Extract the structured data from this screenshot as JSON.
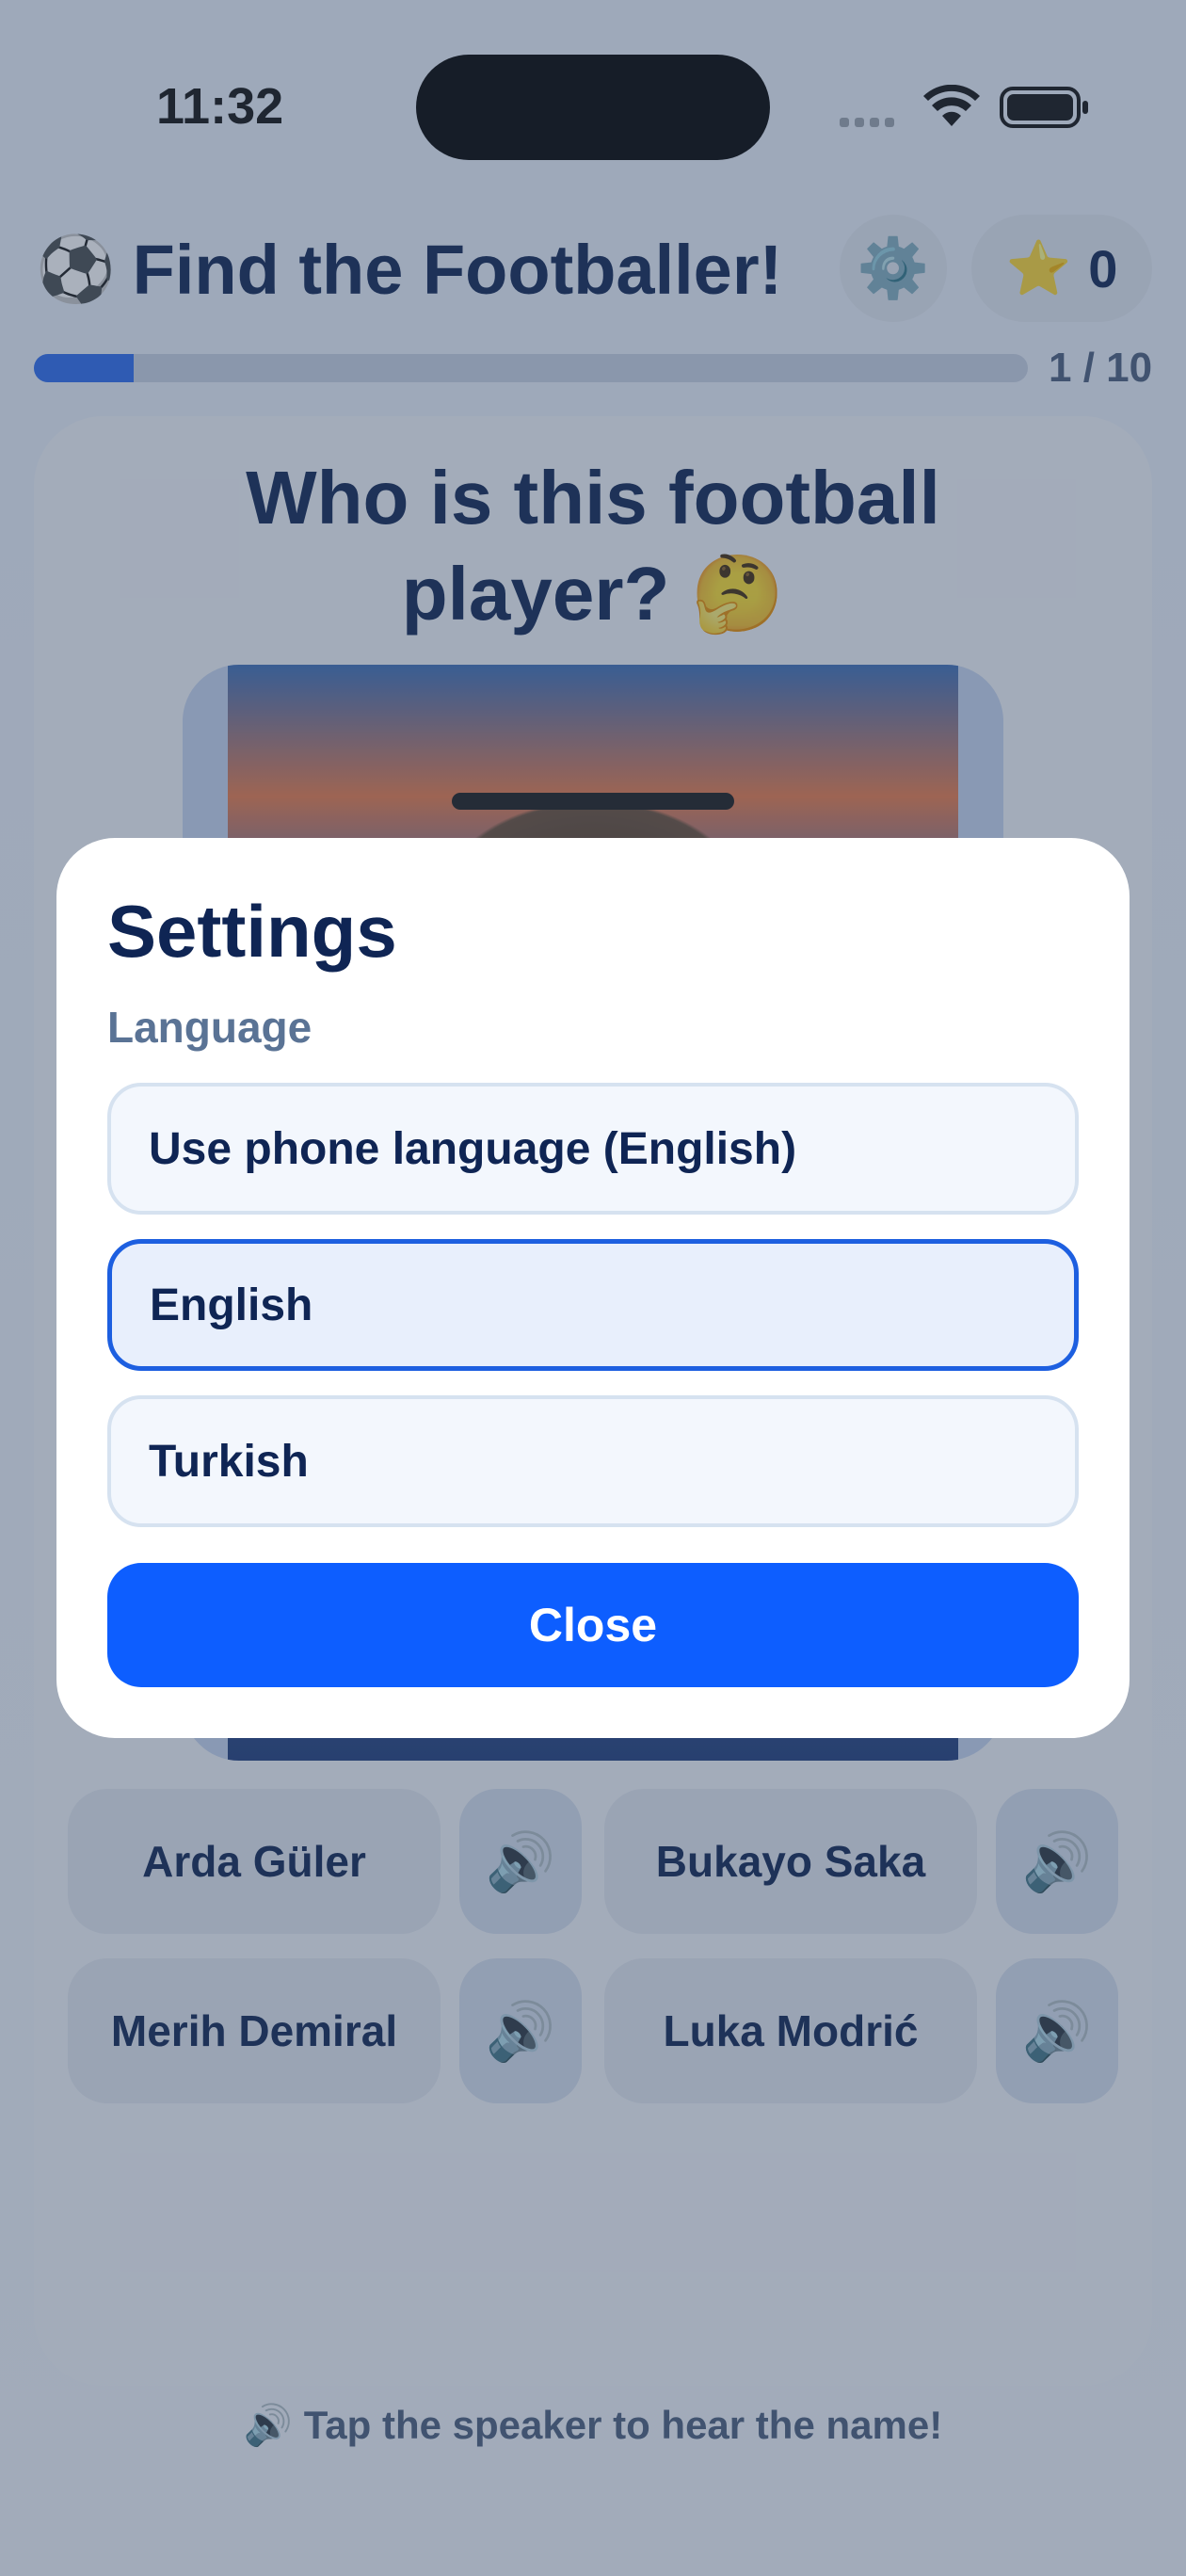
{
  "status_bar": {
    "time": "11:32"
  },
  "header": {
    "title": "Find the Footballer!",
    "ball_emoji": "⚽",
    "settings_emoji": "⚙️",
    "star_emoji": "⭐",
    "score": "0"
  },
  "progress": {
    "text": "1 / 10",
    "value": 0.1
  },
  "question": {
    "text": "Who is this football player? 🤔"
  },
  "options": [
    {
      "label": "Arda Güler"
    },
    {
      "label": "Bukayo Saka"
    },
    {
      "label": "Merih Demiral"
    },
    {
      "label": "Luka Modrić"
    }
  ],
  "speaker_emoji": "🔊",
  "hint": "🔊 Tap the speaker to hear the name!",
  "settings_modal": {
    "title": "Settings",
    "section_label": "Language",
    "language_options": [
      {
        "label": "Use phone language (English)",
        "selected": false
      },
      {
        "label": "English",
        "selected": true
      },
      {
        "label": "Turkish",
        "selected": false
      }
    ],
    "close_label": "Close"
  },
  "colors": {
    "accent": "#0d5eff",
    "title": "#0f2554",
    "selected_border": "#1d5fe0"
  }
}
